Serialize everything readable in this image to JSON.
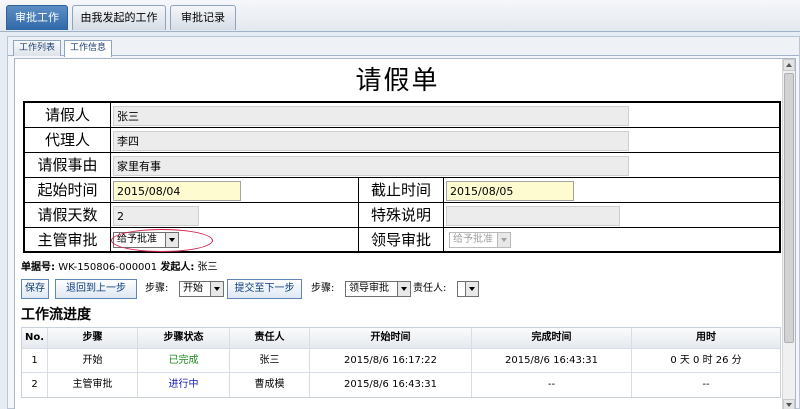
{
  "top_tabs": [
    "审批工作",
    "由我发起的工作",
    "审批记录"
  ],
  "sub_tabs": [
    "工作列表",
    "工作信息"
  ],
  "form": {
    "title": "请假单",
    "applicant_label": "请假人",
    "applicant": "张三",
    "agent_label": "代理人",
    "agent": "李四",
    "reason_label": "请假事由",
    "reason": "家里有事",
    "start_label": "起始时间",
    "start": "2015/08/04",
    "end_label": "截止时间",
    "end": "2015/08/05",
    "days_label": "请假天数",
    "days": "2",
    "special_label": "特殊说明",
    "special": "",
    "supervisor_label": "主管审批",
    "supervisor_value": "给予批准",
    "leader_label": "领导审批",
    "leader_value": "给予批准"
  },
  "meta": {
    "doc_no_label": "单据号:",
    "doc_no": "WK-150806-000001",
    "initiator_label": "发起人:",
    "initiator": "张三"
  },
  "actions": {
    "save": "保存",
    "back": "退回到上一步",
    "step_label_1": "步骤:",
    "step_value_1": "开始",
    "submit": "提交至下一步",
    "step_label_2": "步骤:",
    "step_value_2": "领导审批",
    "owner_label": "责任人:",
    "owner_value": ""
  },
  "progress": {
    "title": "工作流进度",
    "columns": [
      "No.",
      "步骤",
      "步骤状态",
      "责任人",
      "开始时间",
      "完成时间",
      "用时"
    ],
    "rows": [
      [
        "1",
        "开始",
        "已完成",
        "张三",
        "2015/8/6 16:17:22",
        "2015/8/6 16:43:31",
        "0 天 0 时 26 分"
      ],
      [
        "2",
        "主管审批",
        "进行中",
        "曹成模",
        "2015/8/6 16:43:31",
        "--",
        "--"
      ]
    ]
  },
  "colors": {
    "tab_active": "#2f68a8",
    "status_done": "#1a8a1a",
    "status_in_progress": "#1a1ab8",
    "annotation_ellipse": "#d5204a"
  }
}
